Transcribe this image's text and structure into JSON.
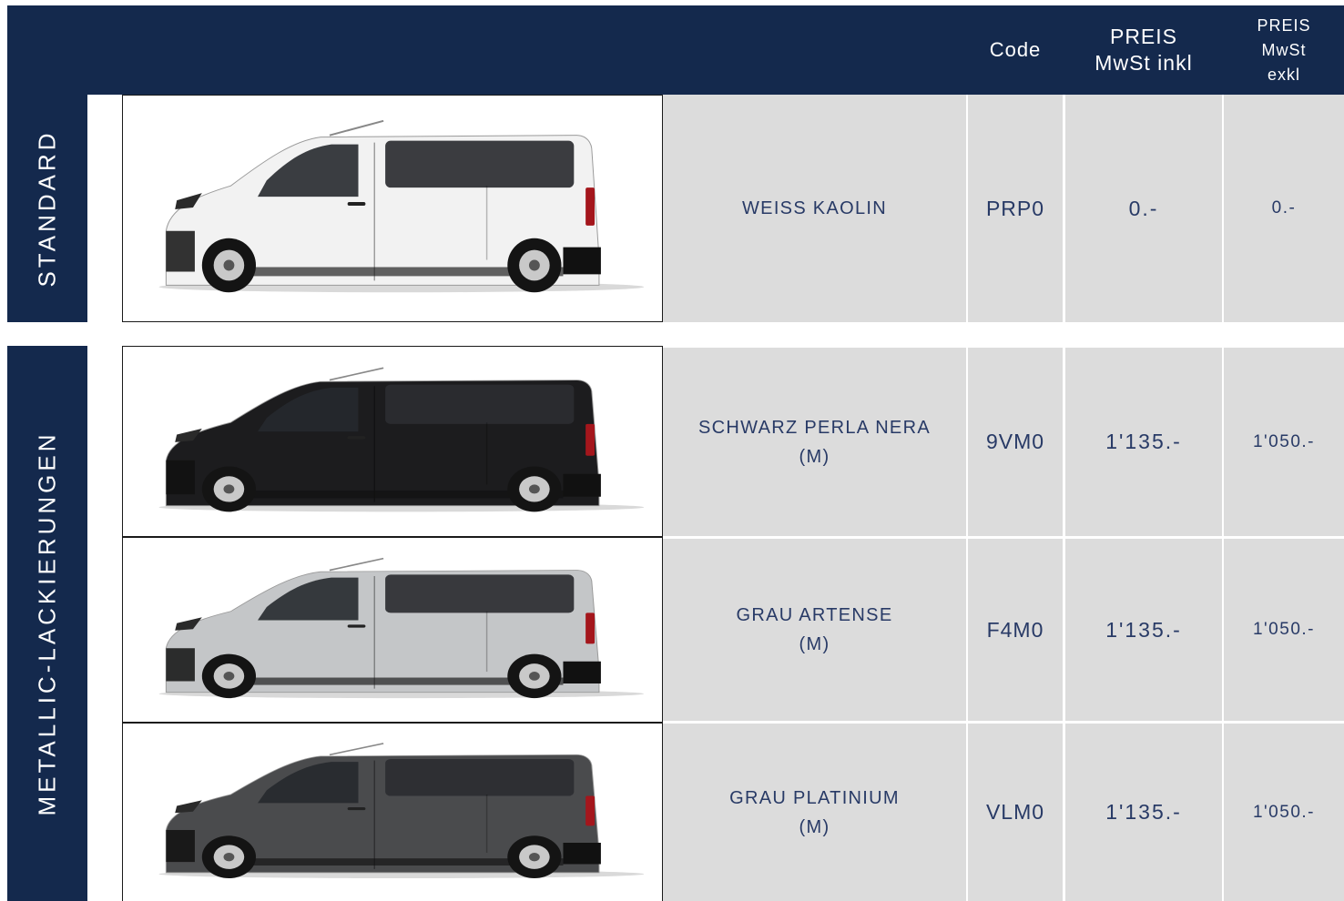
{
  "header": {
    "code": "Code",
    "price_incl_line1": "PREIS",
    "price_incl_line2": "MwSt inkl",
    "price_excl_line1": "PREIS",
    "price_excl_line2": "MwSt",
    "price_excl_line3": "exkl"
  },
  "sections": [
    {
      "label": "STANDARD"
    },
    {
      "label": "METALLIC-LACKIERUNGEN"
    }
  ],
  "rows": [
    {
      "name": "WEISS KAOLIN",
      "suffix": "",
      "code": "PRP0",
      "price_incl": "0.-",
      "price_excl": "0.-",
      "color": "#f2f2f2"
    },
    {
      "name": "SCHWARZ PERLA NERA",
      "suffix": "(M)",
      "code": "9VM0",
      "price_incl": "1'135.-",
      "price_excl": "1'050.-",
      "color": "#1c1c1e"
    },
    {
      "name": "GRAU ARTENSE",
      "suffix": "(M)",
      "code": "F4M0",
      "price_incl": "1'135.-",
      "price_excl": "1'050.-",
      "color": "#c4c6c8"
    },
    {
      "name": "GRAU PLATINIUM",
      "suffix": "(M)",
      "code": "VLM0",
      "price_incl": "1'135.-",
      "price_excl": "1'050.-",
      "color": "#4a4b4d"
    }
  ]
}
